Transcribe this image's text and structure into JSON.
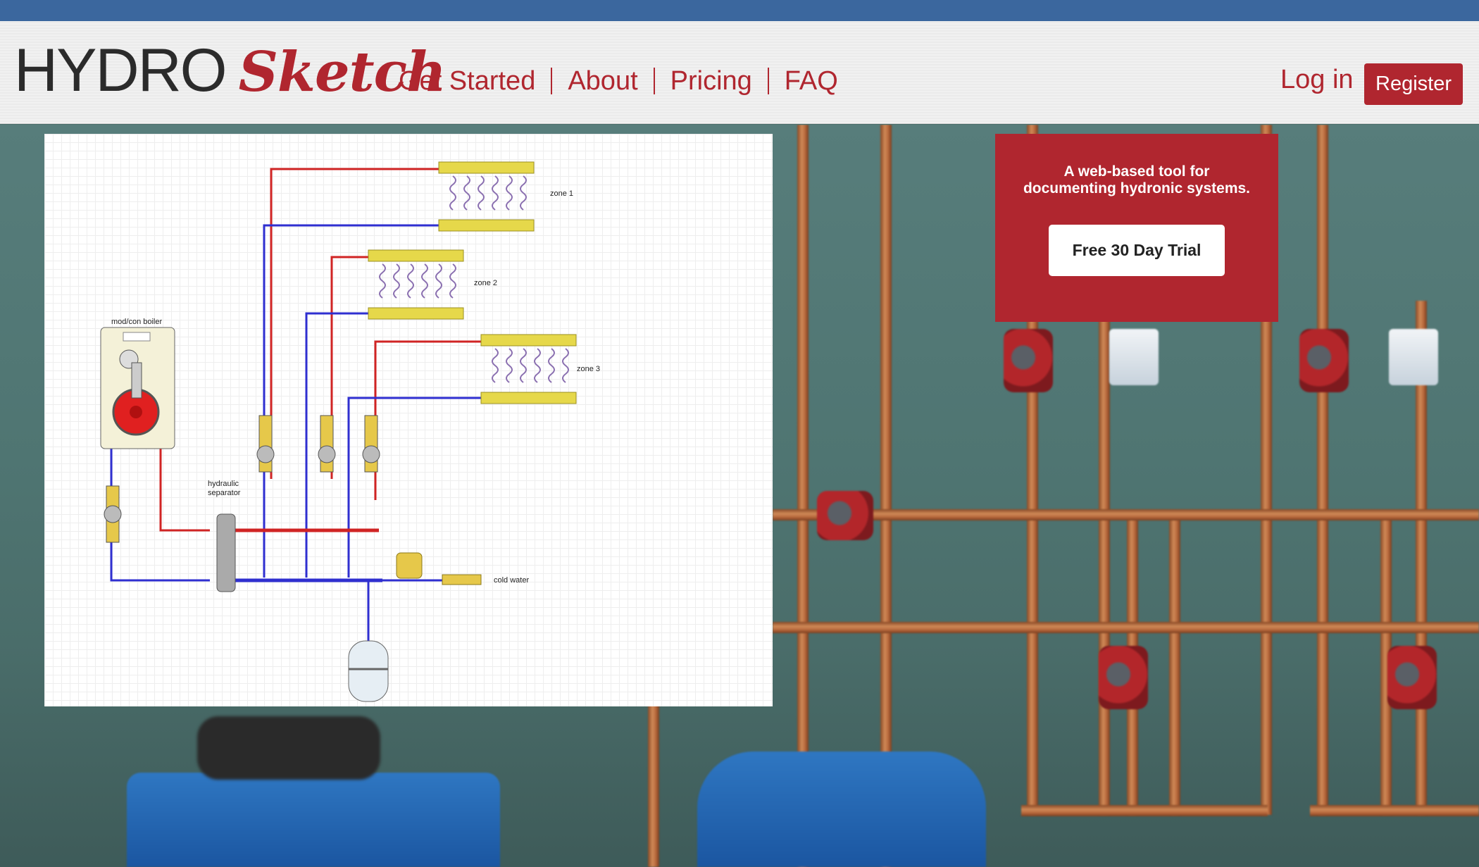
{
  "brand": {
    "logo_part1": "HYDRO",
    "logo_part2": "Sketch",
    "accent_color": "#b0262f",
    "topbar_color": "#3b679e"
  },
  "nav": {
    "items": [
      {
        "label": "Get Started"
      },
      {
        "label": "About"
      },
      {
        "label": "Pricing"
      },
      {
        "label": "FAQ"
      }
    ]
  },
  "auth": {
    "login_label": "Log in",
    "register_label": "Register"
  },
  "promo": {
    "tagline_line1": "A web-based tool for",
    "tagline_line2": "documenting hydronic systems.",
    "cta_label": "Free 30 Day Trial"
  },
  "diagram": {
    "labels": {
      "boiler": "mod/con boiler",
      "separator_line1": "hydraulic",
      "separator_line2": "separator",
      "zone1": "zone 1",
      "zone2": "zone 2",
      "zone3": "zone 3",
      "cold_water": "cold water"
    }
  },
  "icons": {
    "background": "boiler-room-photo"
  }
}
